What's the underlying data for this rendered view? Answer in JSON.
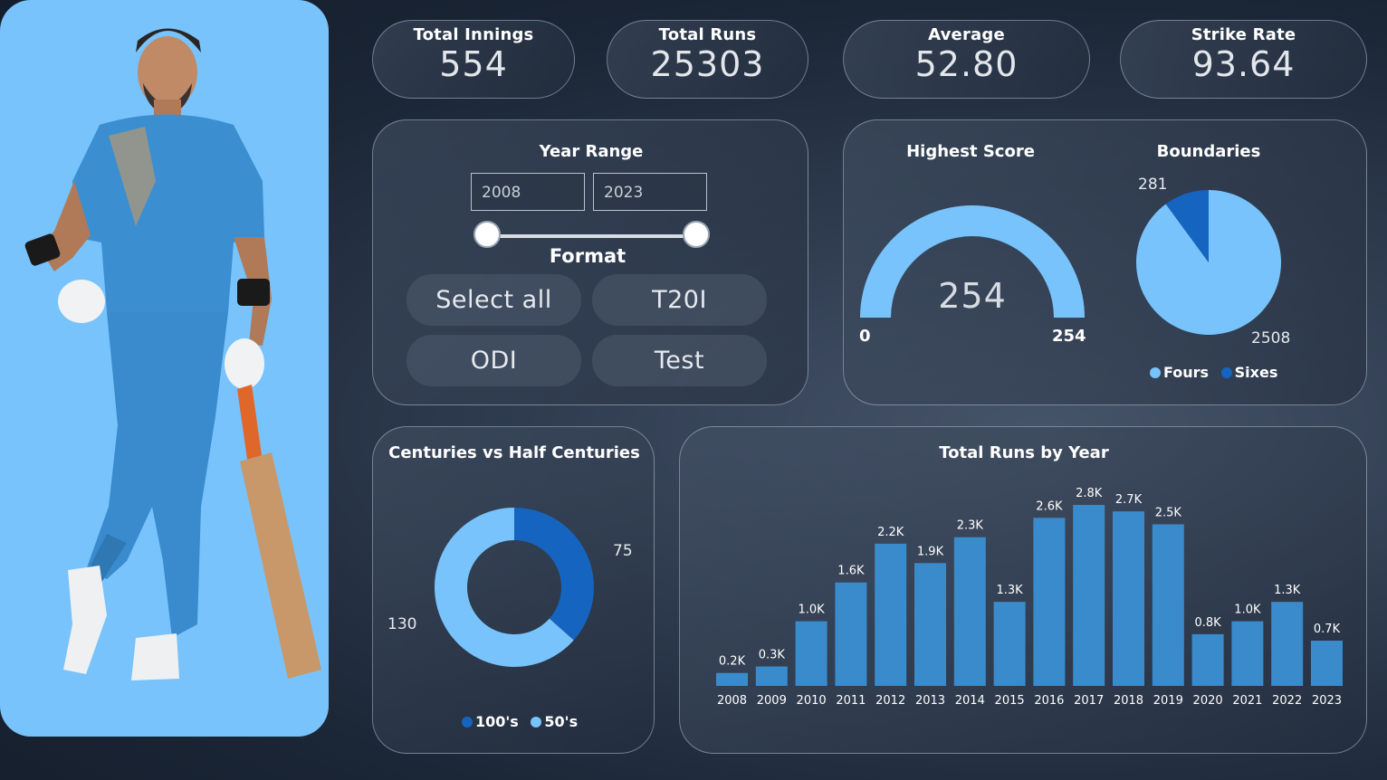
{
  "kpis": {
    "innings": {
      "label": "Total Innings",
      "value": "554"
    },
    "runs": {
      "label": "Total Runs",
      "value": "25303"
    },
    "average": {
      "label": "Average",
      "value": "52.80"
    },
    "strike_rate": {
      "label": "Strike Rate",
      "value": "93.64"
    }
  },
  "filters": {
    "year_range_title": "Year Range",
    "year_from": "2008",
    "year_to": "2023",
    "format_title": "Format",
    "format_buttons": [
      "Select all",
      "T20I",
      "ODI",
      "Test"
    ]
  },
  "highest_score": {
    "title": "Highest Score",
    "value": "254",
    "min_label": "0",
    "max_label": "254"
  },
  "boundaries": {
    "title": "Boundaries",
    "fours_value": "2508",
    "sixes_value": "281",
    "legend": [
      "Fours",
      "Sixes"
    ]
  },
  "centuries": {
    "title": "Centuries vs Half Centuries",
    "hundreds_value": "75",
    "fifties_value": "130",
    "legend": [
      "100's",
      "50's"
    ]
  },
  "colors": {
    "light_blue": "#78c3fb",
    "dark_blue": "#1565c0",
    "bar_blue": "#3a8bcb"
  },
  "chart_data": [
    {
      "type": "bar",
      "title": "Total Runs by Year",
      "categories": [
        "2008",
        "2009",
        "2010",
        "2011",
        "2012",
        "2013",
        "2014",
        "2015",
        "2016",
        "2017",
        "2018",
        "2019",
        "2020",
        "2021",
        "2022",
        "2023"
      ],
      "values": [
        0.2,
        0.3,
        1.0,
        1.6,
        2.2,
        1.9,
        2.3,
        1.3,
        2.6,
        2.8,
        2.7,
        2.5,
        0.8,
        1.0,
        1.3,
        0.7
      ],
      "data_labels": [
        "0.2K",
        "0.3K",
        "1.0K",
        "1.6K",
        "2.2K",
        "1.9K",
        "2.3K",
        "1.3K",
        "2.6K",
        "2.8K",
        "2.7K",
        "2.5K",
        "0.8K",
        "1.0K",
        "1.3K",
        "0.7K"
      ],
      "unit": "K"
    },
    {
      "type": "pie",
      "title": "Boundaries",
      "categories": [
        "Fours",
        "Sixes"
      ],
      "values": [
        2508,
        281
      ]
    },
    {
      "type": "pie",
      "title": "Centuries vs Half Centuries",
      "categories": [
        "100's",
        "50's"
      ],
      "values": [
        75,
        130
      ]
    }
  ]
}
